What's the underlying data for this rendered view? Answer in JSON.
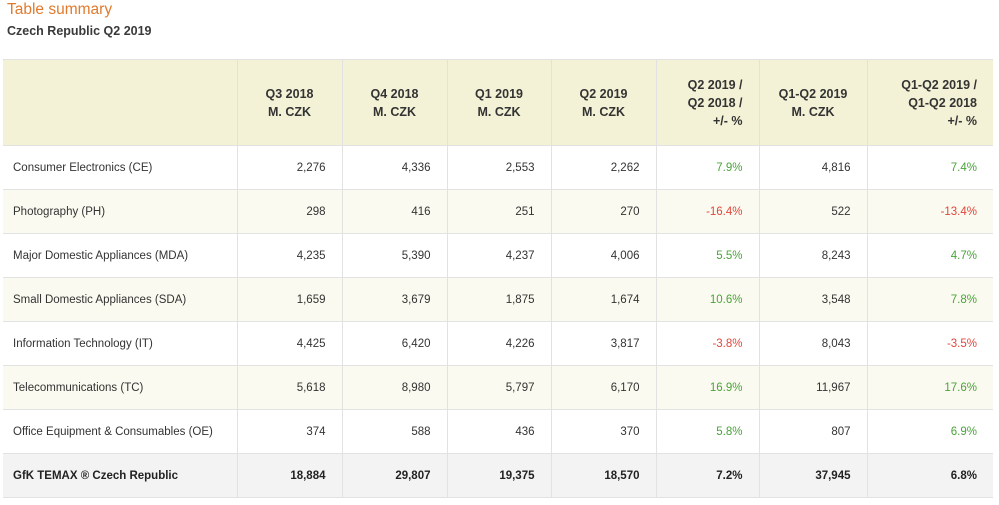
{
  "title": "Table summary",
  "subtitle": "Czech Republic Q2 2019",
  "colors": {
    "title": "#e07a2e",
    "header_bg": "#f4f2d6",
    "positive": "#4aa339",
    "negative": "#e0463c"
  },
  "columns": [
    {
      "lines": [
        "",
        ""
      ]
    },
    {
      "lines": [
        "Q3 2018",
        "M. CZK"
      ]
    },
    {
      "lines": [
        "Q4 2018",
        "M. CZK"
      ]
    },
    {
      "lines": [
        "Q1 2019",
        "M. CZK"
      ]
    },
    {
      "lines": [
        "Q2 2019",
        "M. CZK"
      ]
    },
    {
      "lines": [
        "Q2 2019 /",
        "Q2 2018 /",
        "+/- %"
      ]
    },
    {
      "lines": [
        "Q1-Q2 2019",
        "M. CZK"
      ]
    },
    {
      "lines": [
        "Q1-Q2 2019 /",
        "Q1-Q2 2018",
        "+/- %"
      ]
    }
  ],
  "rows": [
    {
      "label": "Consumer Electronics (CE)",
      "q3_2018": "2,276",
      "q4_2018": "4,336",
      "q1_2019": "2,553",
      "q2_2019": "2,262",
      "q2_change": "7.9%",
      "h1_2019": "4,816",
      "h1_change": "7.4%"
    },
    {
      "label": "Photography (PH)",
      "q3_2018": "298",
      "q4_2018": "416",
      "q1_2019": "251",
      "q2_2019": "270",
      "q2_change": "-16.4%",
      "h1_2019": "522",
      "h1_change": "-13.4%"
    },
    {
      "label": "Major Domestic Appliances (MDA)",
      "q3_2018": "4,235",
      "q4_2018": "5,390",
      "q1_2019": "4,237",
      "q2_2019": "4,006",
      "q2_change": "5.5%",
      "h1_2019": "8,243",
      "h1_change": "4.7%"
    },
    {
      "label": "Small Domestic Appliances (SDA)",
      "q3_2018": "1,659",
      "q4_2018": "3,679",
      "q1_2019": "1,875",
      "q2_2019": "1,674",
      "q2_change": "10.6%",
      "h1_2019": "3,548",
      "h1_change": "7.8%"
    },
    {
      "label": "Information Technology (IT)",
      "q3_2018": "4,425",
      "q4_2018": "6,420",
      "q1_2019": "4,226",
      "q2_2019": "3,817",
      "q2_change": "-3.8%",
      "h1_2019": "8,043",
      "h1_change": "-3.5%"
    },
    {
      "label": "Telecommunications (TC)",
      "q3_2018": "5,618",
      "q4_2018": "8,980",
      "q1_2019": "5,797",
      "q2_2019": "6,170",
      "q2_change": "16.9%",
      "h1_2019": "11,967",
      "h1_change": "17.6%"
    },
    {
      "label": "Office Equipment & Consumables (OE)",
      "q3_2018": "374",
      "q4_2018": "588",
      "q1_2019": "436",
      "q2_2019": "370",
      "q2_change": "5.8%",
      "h1_2019": "807",
      "h1_change": "6.9%"
    }
  ],
  "total": {
    "label": "GfK TEMAX ® Czech Republic",
    "q3_2018": "18,884",
    "q4_2018": "29,807",
    "q1_2019": "19,375",
    "q2_2019": "18,570",
    "q2_change": "7.2%",
    "h1_2019": "37,945",
    "h1_change": "6.8%"
  }
}
